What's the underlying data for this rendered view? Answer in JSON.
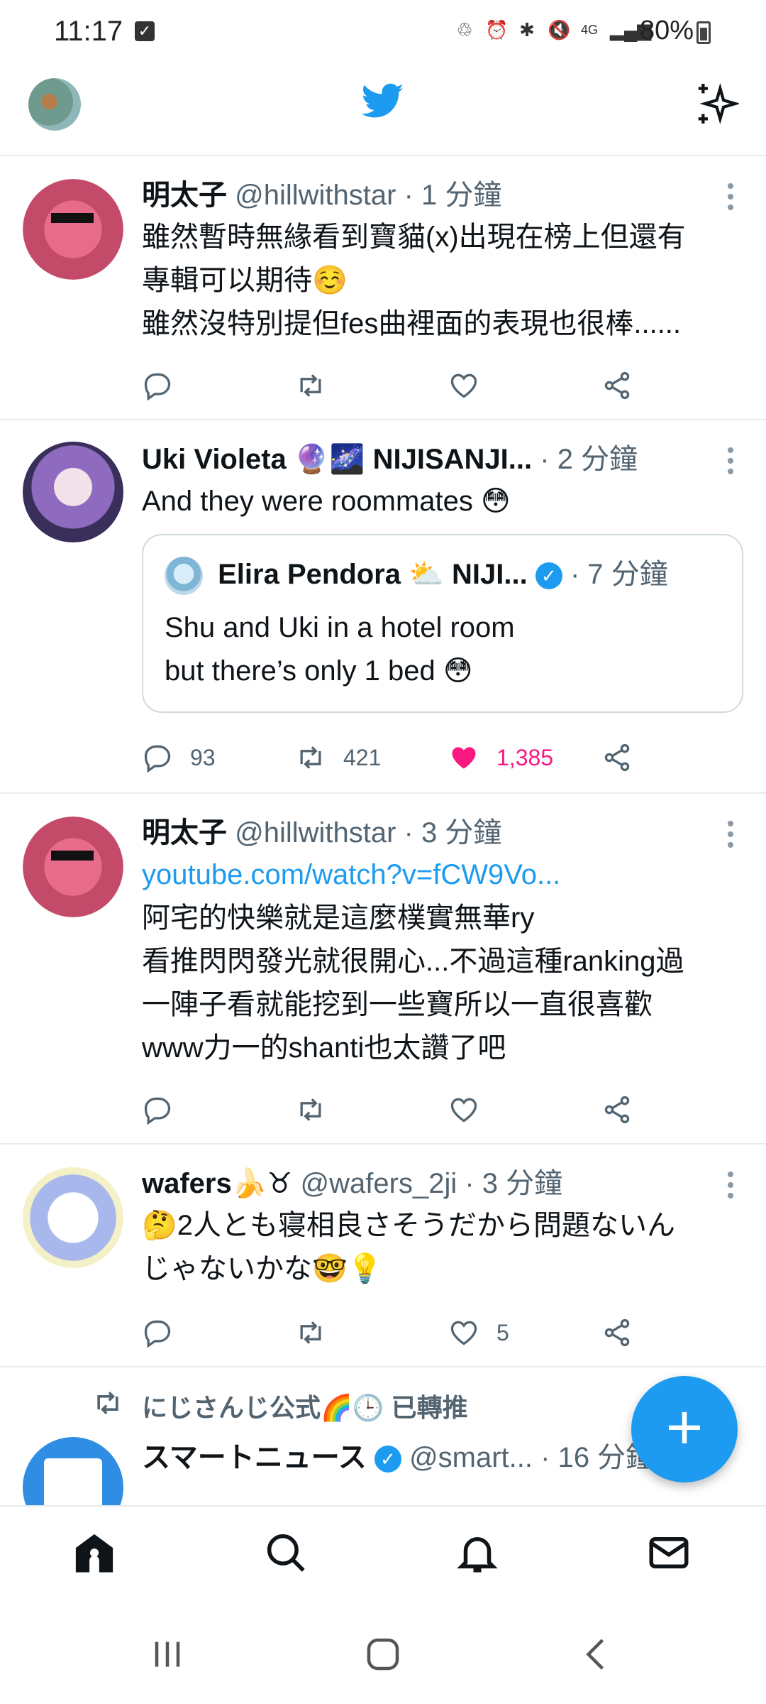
{
  "status_bar": {
    "time": "11:17",
    "battery": "80%",
    "icons": [
      "recycle-icon",
      "alarm-icon",
      "bluetooth-icon",
      "mute-icon",
      "4g-icon",
      "signal-icon"
    ]
  },
  "header": {
    "logo": "twitter-bird-icon",
    "sparkle": "sparkle-icon"
  },
  "tweets": [
    {
      "name": "明太子",
      "handle": "@hillwithstar",
      "time": "· 1 分鐘",
      "lines": [
        "雖然暫時無緣看到寶貓(x)出現在榜上但還有",
        "專輯可以期待☺️",
        "雖然沒特別提但fes曲裡面的表現也很棒......"
      ],
      "reply_count": "",
      "retweet_count": "",
      "like_count": ""
    },
    {
      "name": "Uki Violeta 🔮🌌 NIJISANJI...",
      "time": "· 2 分鐘",
      "lines": [
        "And they were roommates 😳"
      ],
      "quote": {
        "name": "Elira Pendora ⛅ NIJI...",
        "time": "· 7 分鐘",
        "lines": [
          "Shu and Uki in a hotel room",
          "but there’s only 1 bed 😳"
        ]
      },
      "reply_count": "93",
      "retweet_count": "421",
      "like_count": "1,385"
    },
    {
      "name": "明太子",
      "handle": "@hillwithstar",
      "time": "· 3 分鐘",
      "link": "youtube.com/watch?v=fCW9Vo...",
      "lines": [
        "阿宅的快樂就是這麼樸實無華ry",
        "看推閃閃發光就很開心...不過這種ranking過",
        "一陣子看就能挖到一些寶所以一直很喜歡",
        "www力一的shanti也太讚了吧"
      ],
      "reply_count": "",
      "retweet_count": "",
      "like_count": ""
    },
    {
      "name": "wafers🍌♉",
      "handle": "@wafers_2ji",
      "time": "· 3 分鐘",
      "lines": [
        "🤔2人とも寝相良さそうだから問題ないん",
        "じゃないかな🤓💡"
      ],
      "reply_count": "",
      "retweet_count": "",
      "like_count": "5"
    }
  ],
  "retweet_context": "にじさんじ公式🌈🕒 已轉推",
  "partial_tweet": {
    "name": "スマートニュース",
    "handle": "@smart...",
    "time": "· 16 分鐘"
  },
  "fab_label": "+",
  "bottom_nav": [
    "home-icon",
    "search-icon",
    "bell-icon",
    "mail-icon"
  ],
  "system_nav": [
    "recents-icon",
    "home-button-icon",
    "back-icon"
  ],
  "colors": {
    "accent": "#1d9bf0",
    "like": "#f91880",
    "muted": "#536471",
    "divider": "#e6ecf0"
  }
}
